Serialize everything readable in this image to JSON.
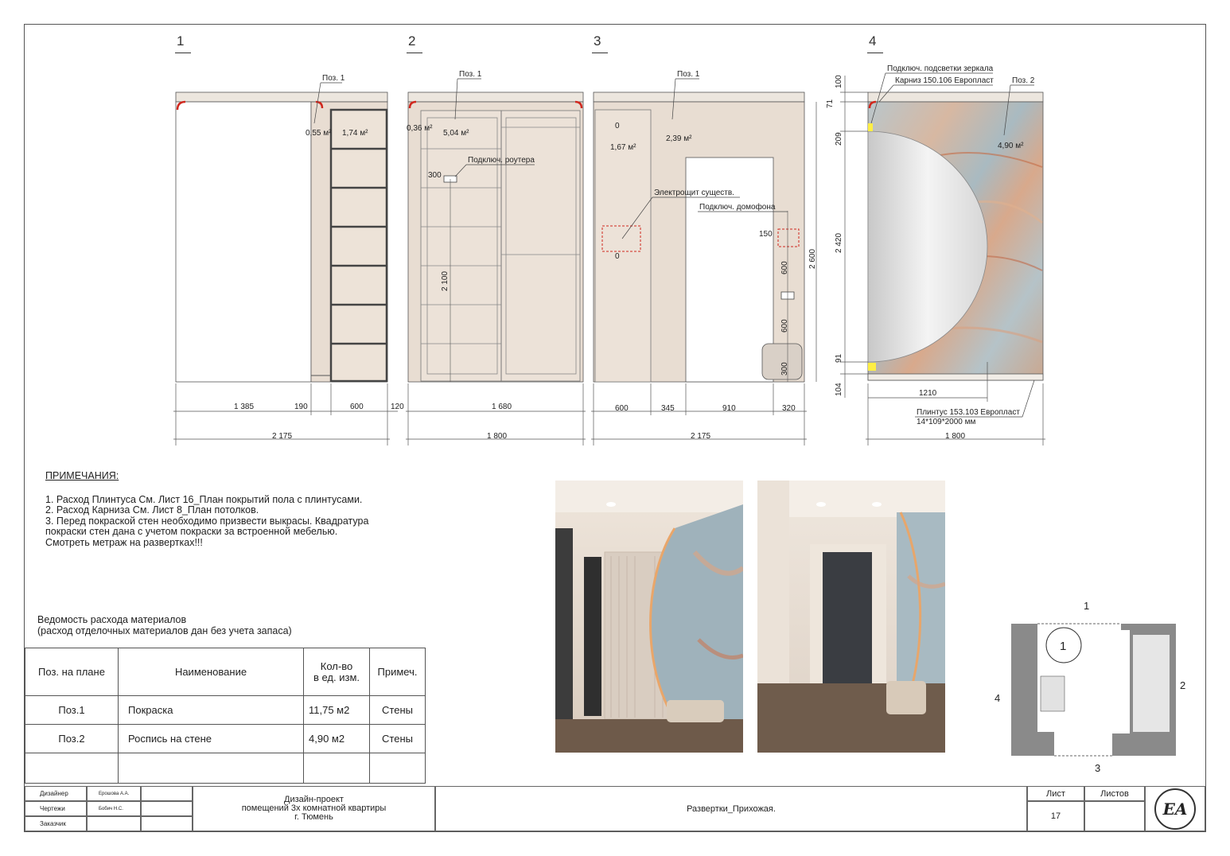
{
  "elevations": {
    "e1": {
      "num": "1",
      "pos": "Поз. 1",
      "area_a": "0,55 м²",
      "area_b": "1,74 м²",
      "dims": [
        "1 385",
        "190",
        "600",
        "120"
      ],
      "total": "2 175"
    },
    "e2": {
      "num": "2",
      "pos": "Поз. 1",
      "area_a": "0,36 м²",
      "area_b": "5,04 м²",
      "router": "Подключ. роутера",
      "d300": "300",
      "h2100": "2 100",
      "dims": [
        "1 680"
      ],
      "total": "1 800"
    },
    "e3": {
      "num": "3",
      "pos": "Поз. 1",
      "area_a": "1,67 м²",
      "area_b": "2,39 м²",
      "panel": "Электрощит существ.",
      "intercom": "Подключ. домофона",
      "zero_a": "0",
      "zero_b": "0",
      "d150": "150",
      "d600a": "600",
      "d600b": "600",
      "d300": "300",
      "h2600": "2 600",
      "dims": [
        "600",
        "345",
        "910",
        "320"
      ],
      "total": "2 175"
    },
    "e4": {
      "num": "4",
      "mirror_light": "Подключ. подсветки зеркала",
      "cornice": "Карниз 150.106 Европласт",
      "pos2": "Поз. 2",
      "area": "4,90 м²",
      "v_dims": [
        "100",
        "71",
        "209",
        "2 420",
        "91",
        "104"
      ],
      "d1210": "1210",
      "plinth": "Плинтус 153.103 Европласт",
      "plinth_size": "14*109*2000 мм",
      "total": "1 800"
    }
  },
  "notes": {
    "title": "ПРИМЕЧАНИЯ:",
    "lines": [
      "1.  Расход Плинтуса  См. Лист 16_План покрытий пола с плинтусами.",
      "2. Расход Карниза    См. Лист 8_План потолков.",
      "3. Перед покраской стен необходимо призвести выкрасы. Квадратура",
      "покраски стен дана с учетом покраски за встроенной мебелью.",
      "Смотреть метраж на развертках!!!"
    ]
  },
  "materials": {
    "title1": "Ведомость расхода материалов",
    "title2": "(расход отделочных материалов дан без учета запаса)",
    "headers": [
      "Поз. на плане",
      "Наименование",
      "Кол-во",
      "в ед. изм.",
      "Примеч."
    ],
    "rows": [
      {
        "pos": "Поз.1",
        "name": "Покраска",
        "qty": "11,75 м2",
        "note": "Стены"
      },
      {
        "pos": "Поз.2",
        "name": "Роспись на стене",
        "qty": "4,90 м2",
        "note": "Стены"
      }
    ]
  },
  "key_plan": {
    "n1": "1",
    "n2": "2",
    "n3": "3",
    "n4": "4",
    "circle": "1"
  },
  "stamp": {
    "roles": [
      "Дизайнер",
      "Чертежи",
      "Заказчик"
    ],
    "names": [
      "Ерошова А.А.",
      "Бобич Н.С.",
      ""
    ],
    "project1": "Дизайн-проект",
    "project2": "помещений 3х комнатной квартиры",
    "project3": "г. Тюмень",
    "sheet_title": "Развертки_Прихожая.",
    "sheet_label": "Лист",
    "sheets_label": "Листов",
    "sheet_no": "17",
    "logo": "EA"
  },
  "colors": {
    "wall": "#e8ddd2",
    "furniture": "#ece2d8",
    "dark": "#4a4a4a",
    "accent": "#d0281e"
  }
}
